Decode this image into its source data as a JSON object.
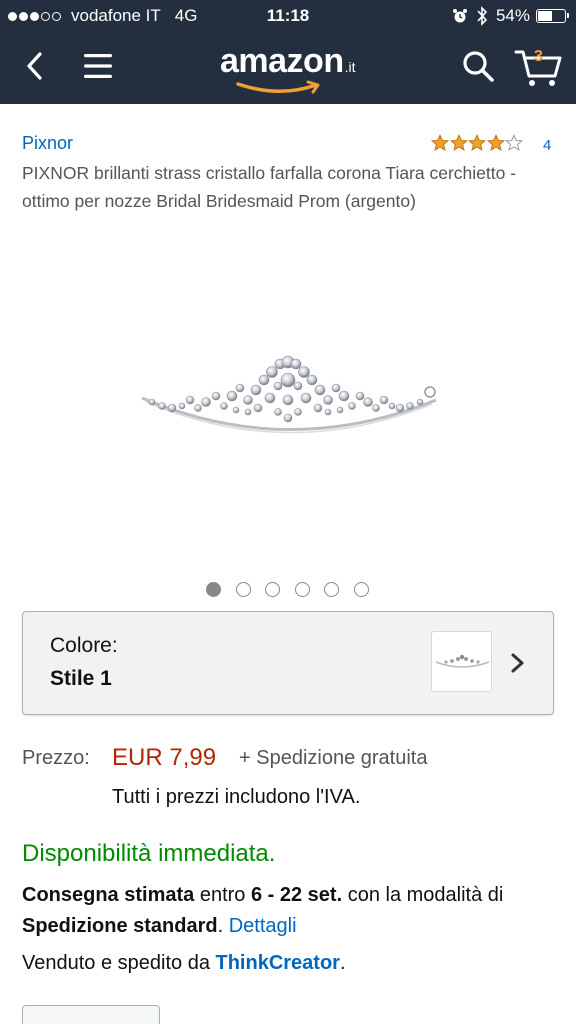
{
  "status_bar": {
    "carrier": "vodafone IT",
    "network": "4G",
    "time": "11:18",
    "battery": "54%",
    "battery_level": 0.54,
    "signal_bars_filled": 3,
    "signal_bars_total": 5
  },
  "header": {
    "logo_text": "amazon",
    "logo_tld": ".it",
    "cart_count": "3",
    "icons": [
      "back-icon",
      "menu-icon",
      "search-icon",
      "cart-icon"
    ],
    "colors": {
      "background": "#232f3e",
      "accent": "#f0a030"
    }
  },
  "product": {
    "brand": "Pixnor",
    "rating": 4,
    "rating_max": 5,
    "review_count": "4",
    "title": "PIXNOR brillanti strass cristallo farfalla corona Tiara cerchietto - ottimo per nozze Bridal Bridesmaid Prom (argento)",
    "image_count": 6,
    "active_image": 1
  },
  "color_selector": {
    "label": "Colore:",
    "value": "Stile 1"
  },
  "price": {
    "label": "Prezzo:",
    "value": "EUR 7,99",
    "shipping": "+ Spedizione gratuita",
    "vat_note": "Tutti i prezzi includono l'IVA."
  },
  "availability": {
    "status": "Disponibilità immediata.",
    "delivery_bold_1": "Consegna stimata",
    "delivery_text_1": " entro ",
    "delivery_bold_2": "6 - 22 set.",
    "delivery_text_2": " con la modalità di ",
    "delivery_bold_3": "Spedizione standard",
    "delivery_text_3": ". ",
    "details_link": "Dettagli",
    "seller_prefix": "Venduto e spedito da ",
    "seller_name": "ThinkCreator",
    "seller_suffix": "."
  }
}
